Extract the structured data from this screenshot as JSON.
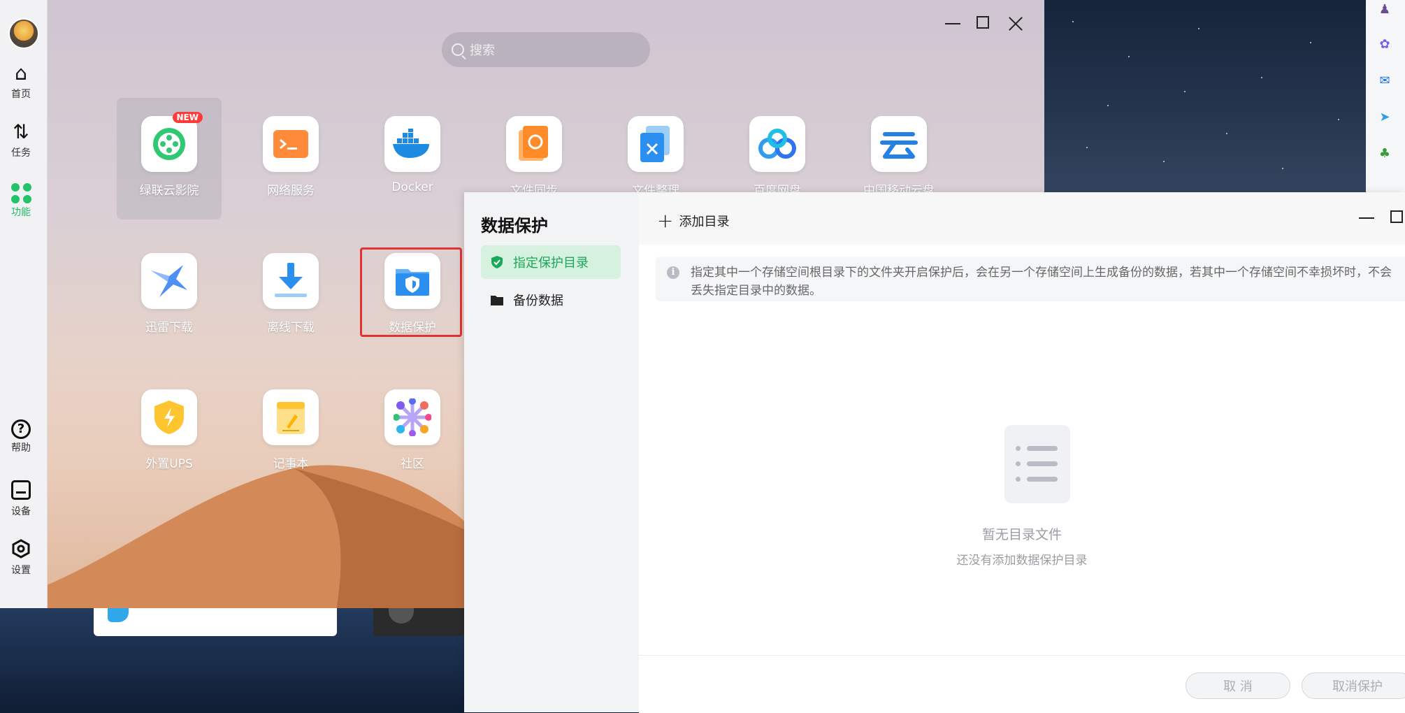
{
  "launcher": {
    "search_placeholder": "搜索",
    "nav": [
      {
        "label": "首页",
        "icon": "home-icon"
      },
      {
        "label": "任务",
        "icon": "transfer-arrows-icon"
      },
      {
        "label": "功能",
        "icon": "grid-dots-icon",
        "active": true
      },
      {
        "label": "帮助",
        "icon": "help-icon"
      },
      {
        "label": "设备",
        "icon": "device-icon"
      },
      {
        "label": "设置",
        "icon": "settings-icon"
      }
    ],
    "apps": [
      {
        "label": "绿联云影院",
        "icon": "film-reel-icon",
        "badge": "NEW"
      },
      {
        "label": "网络服务",
        "icon": "terminal-icon"
      },
      {
        "label": "Docker",
        "icon": "docker-whale-icon"
      },
      {
        "label": "文件同步",
        "icon": "file-sync-icon"
      },
      {
        "label": "文件整理",
        "icon": "file-organize-icon"
      },
      {
        "label": "百度网盘",
        "icon": "baidu-netdisk-icon"
      },
      {
        "label": "中国移动云盘",
        "icon": "cloud-logo-icon"
      },
      {
        "label": "迅雷下载",
        "icon": "thunder-bird-icon"
      },
      {
        "label": "离线下载",
        "icon": "download-arrow-icon"
      },
      {
        "label": "数据保护",
        "icon": "shield-folder-icon"
      },
      {
        "label": "外置UPS",
        "icon": "lightning-shield-icon"
      },
      {
        "label": "记事本",
        "icon": "notepad-icon"
      },
      {
        "label": "社区",
        "icon": "community-icon"
      }
    ]
  },
  "dp_window": {
    "title": "数据保护",
    "nav": [
      {
        "label": "指定保护目录",
        "icon": "shield-check-icon",
        "active": true
      },
      {
        "label": "备份数据",
        "icon": "folder-icon"
      }
    ],
    "add_label": "添加目录",
    "info_text": "指定其中一个存储空间根目录下的文件夹开启保护后，会在另一个存储空间上生成备份的数据，若其中一个存储空间不幸损坏时，不会丢失指定目录中的数据。",
    "empty_title": "暂无目录文件",
    "empty_subtitle": "还没有添加数据保护目录",
    "cancel_label": "取 消",
    "cancel_protect_label": "取消保护"
  },
  "colors": {
    "accent_green": "#1ebd66",
    "highlight_red": "#e23232",
    "badge_red": "#ff3b3b"
  }
}
